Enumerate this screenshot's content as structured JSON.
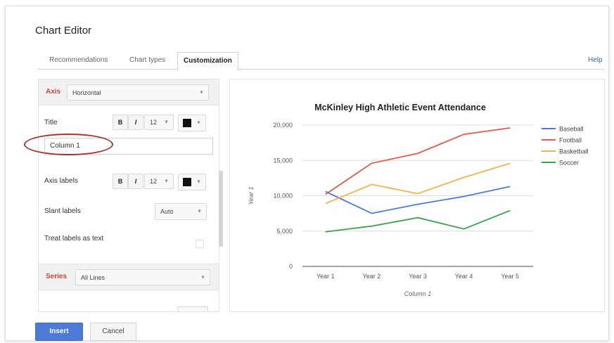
{
  "dialog": {
    "title": "Chart Editor",
    "help": "Help"
  },
  "tabs": [
    "Recommendations",
    "Chart types",
    "Customization"
  ],
  "left": {
    "axis_label": "Axis",
    "axis_value": "Horizontal",
    "title_label": "Title",
    "title_bold": "B",
    "title_italic": "I",
    "title_size": "12",
    "title_input": "Column 1",
    "axis_labels_label": "Axis labels",
    "axis_labels_bold": "B",
    "axis_labels_italic": "I",
    "axis_labels_size": "12",
    "slant_label": "Slant labels",
    "slant_value": "Auto",
    "treat_label": "Treat labels as text",
    "series_label": "Series",
    "series_value": "All Lines"
  },
  "buttons": {
    "insert": "Insert",
    "cancel": "Cancel"
  },
  "colors": {
    "baseball": "#4e7ad7",
    "football": "#e35b4c",
    "basketball": "#f2b14c",
    "soccer": "#3aa34f",
    "accent": "#d14836"
  },
  "chart_data": {
    "type": "line",
    "title": "McKinley High Athletic Event Attendance",
    "xlabel": "Column 1",
    "ylabel": "Year 1",
    "categories": [
      "Year 1",
      "Year 2",
      "Year 3",
      "Year 4",
      "Year 5"
    ],
    "ylim": [
      0,
      20000
    ],
    "yticks": [
      "0",
      "5,000",
      "10,000",
      "15,000",
      "20,000"
    ],
    "grid": true,
    "legend": "right",
    "series": [
      {
        "name": "Baseball",
        "values": [
          10600,
          7500,
          8800,
          9900,
          11300
        ]
      },
      {
        "name": "Football",
        "values": [
          10200,
          14600,
          16000,
          18700,
          19600
        ]
      },
      {
        "name": "Basketball",
        "values": [
          8900,
          11600,
          10300,
          12600,
          14600
        ]
      },
      {
        "name": "Soccer",
        "values": [
          4900,
          5700,
          6900,
          5300,
          7900
        ]
      }
    ]
  }
}
